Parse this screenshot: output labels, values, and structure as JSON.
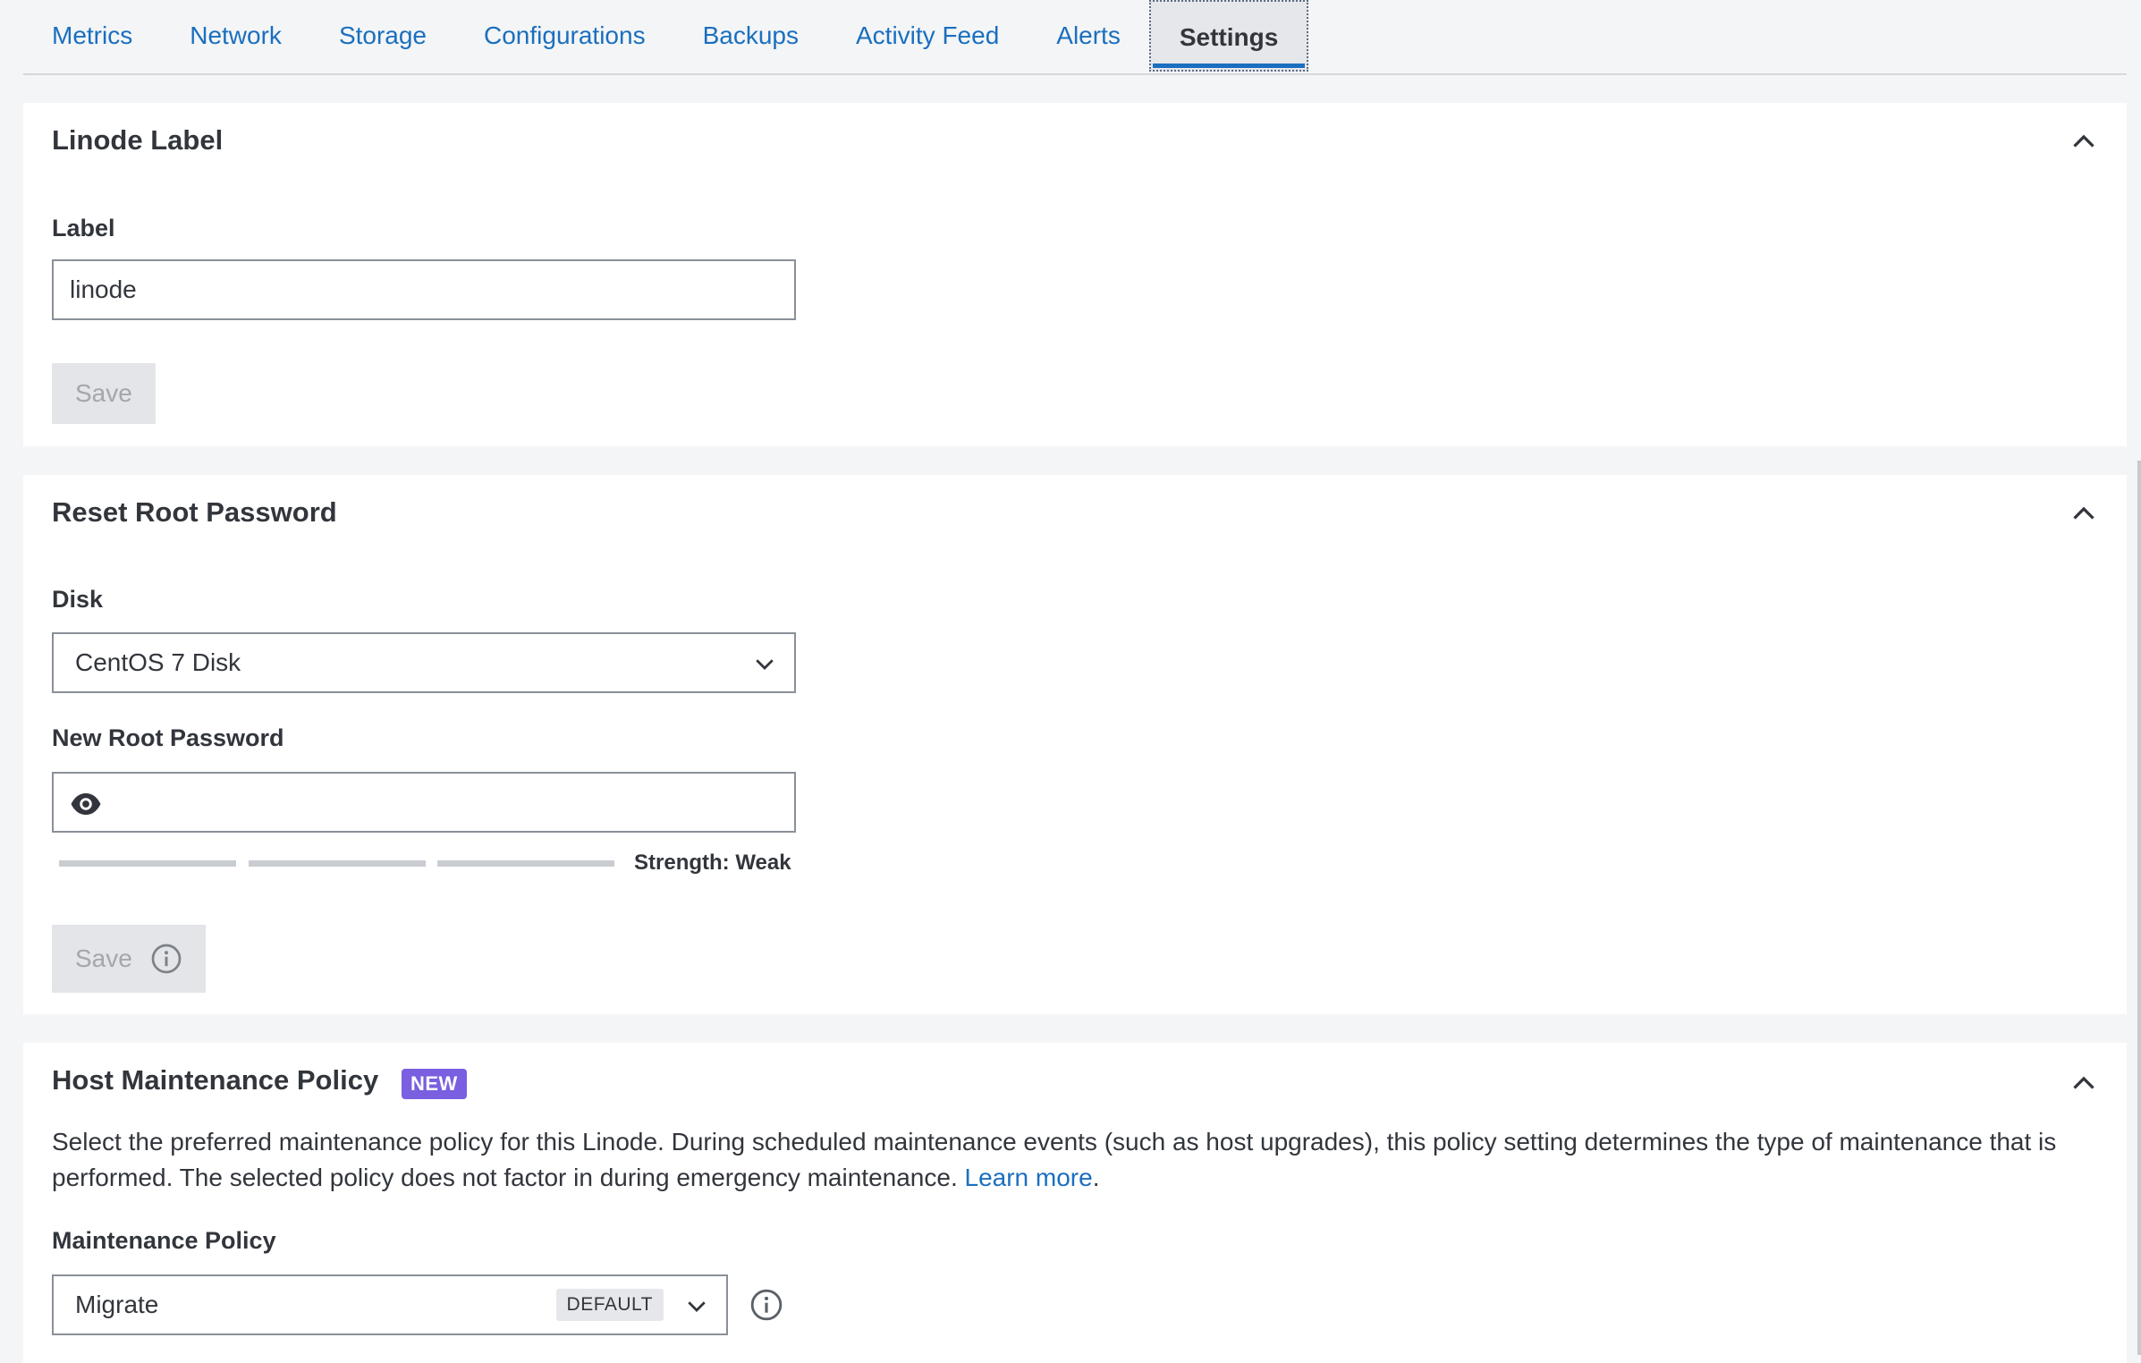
{
  "tabs": [
    {
      "label": "Metrics"
    },
    {
      "label": "Network"
    },
    {
      "label": "Storage"
    },
    {
      "label": "Configurations"
    },
    {
      "label": "Backups"
    },
    {
      "label": "Activity Feed"
    },
    {
      "label": "Alerts"
    },
    {
      "label": "Settings",
      "active": true
    }
  ],
  "label_section": {
    "title": "Linode Label",
    "field_label": "Label",
    "value": "linode",
    "save": "Save"
  },
  "password_section": {
    "title": "Reset Root Password",
    "disk_label": "Disk",
    "disk_value": "CentOS 7 Disk",
    "password_label": "New Root Password",
    "password_value": "",
    "strength_text": "Strength: Weak",
    "save": "Save"
  },
  "maintenance_section": {
    "title": "Host Maintenance Policy",
    "badge": "NEW",
    "description": "Select the preferred maintenance policy for this Linode. During scheduled maintenance events (such as host upgrades), this policy setting determines the type of maintenance that is performed. The selected policy does not factor in during emergency maintenance.",
    "learn_more": "Learn more",
    "learn_more_suffix": ".",
    "policy_label": "Maintenance Policy",
    "policy_value": "Migrate",
    "default_chip": "DEFAULT"
  },
  "colors": {
    "accent": "#1a6fbf",
    "badge_new": "#7a5fe0",
    "background": "#f4f5f6"
  }
}
